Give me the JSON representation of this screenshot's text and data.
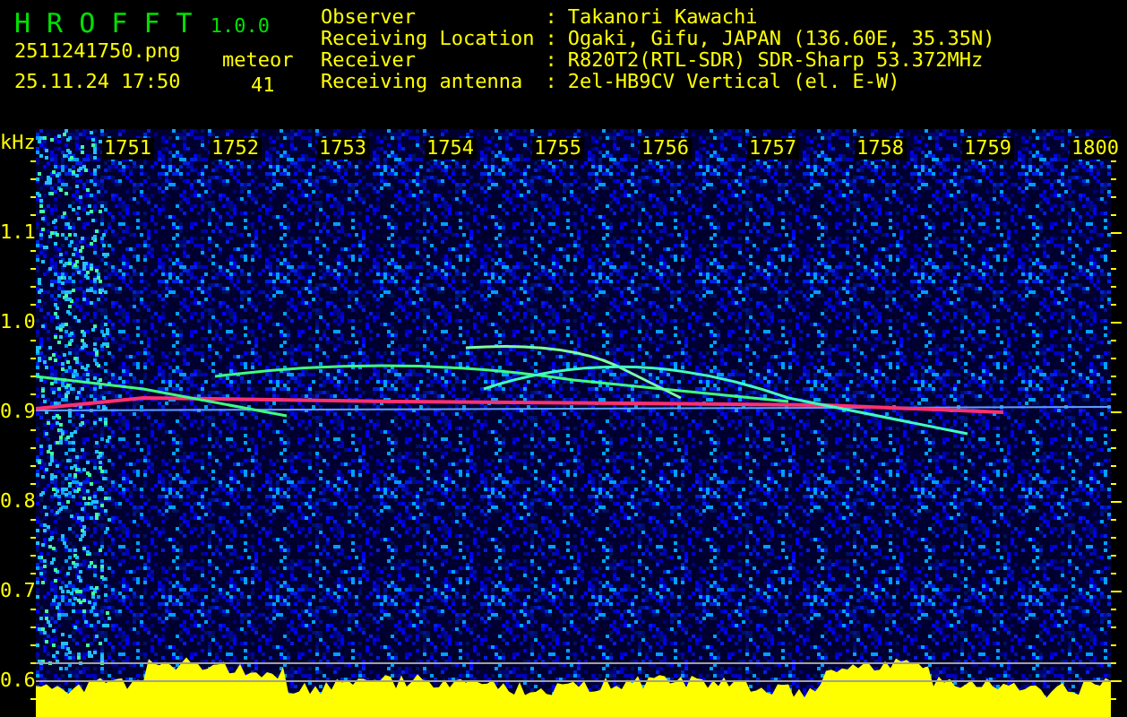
{
  "app": {
    "name": "H R O F F T",
    "version": "1.0.0"
  },
  "file": {
    "name": "2511241750.png",
    "datetime": "25.11.24 17:50"
  },
  "counter": {
    "label": "meteor",
    "value": "41"
  },
  "station": [
    {
      "label": "Observer",
      "separator": ":",
      "value": "Takanori Kawachi"
    },
    {
      "label": "Receiving Location",
      "separator": ":",
      "value": "Ogaki, Gifu, JAPAN (136.60E, 35.35N)"
    },
    {
      "label": "Receiver",
      "separator": ":",
      "value": "R820T2(RTL-SDR) SDR-Sharp 53.372MHz"
    },
    {
      "label": "Receiving antenna",
      "separator": ":",
      "value": "2el-HB9CV Vertical (el. E-W)"
    }
  ],
  "spectrogram": {
    "y_unit": "kHz",
    "x_ticks": [
      "1751",
      "1752",
      "1753",
      "1754",
      "1755",
      "1756",
      "1757",
      "1758",
      "1759",
      "1800"
    ],
    "y_ticks": [
      "1.1",
      "1.0",
      "0.9",
      "0.8",
      "0.7",
      "0.6"
    ]
  }
}
